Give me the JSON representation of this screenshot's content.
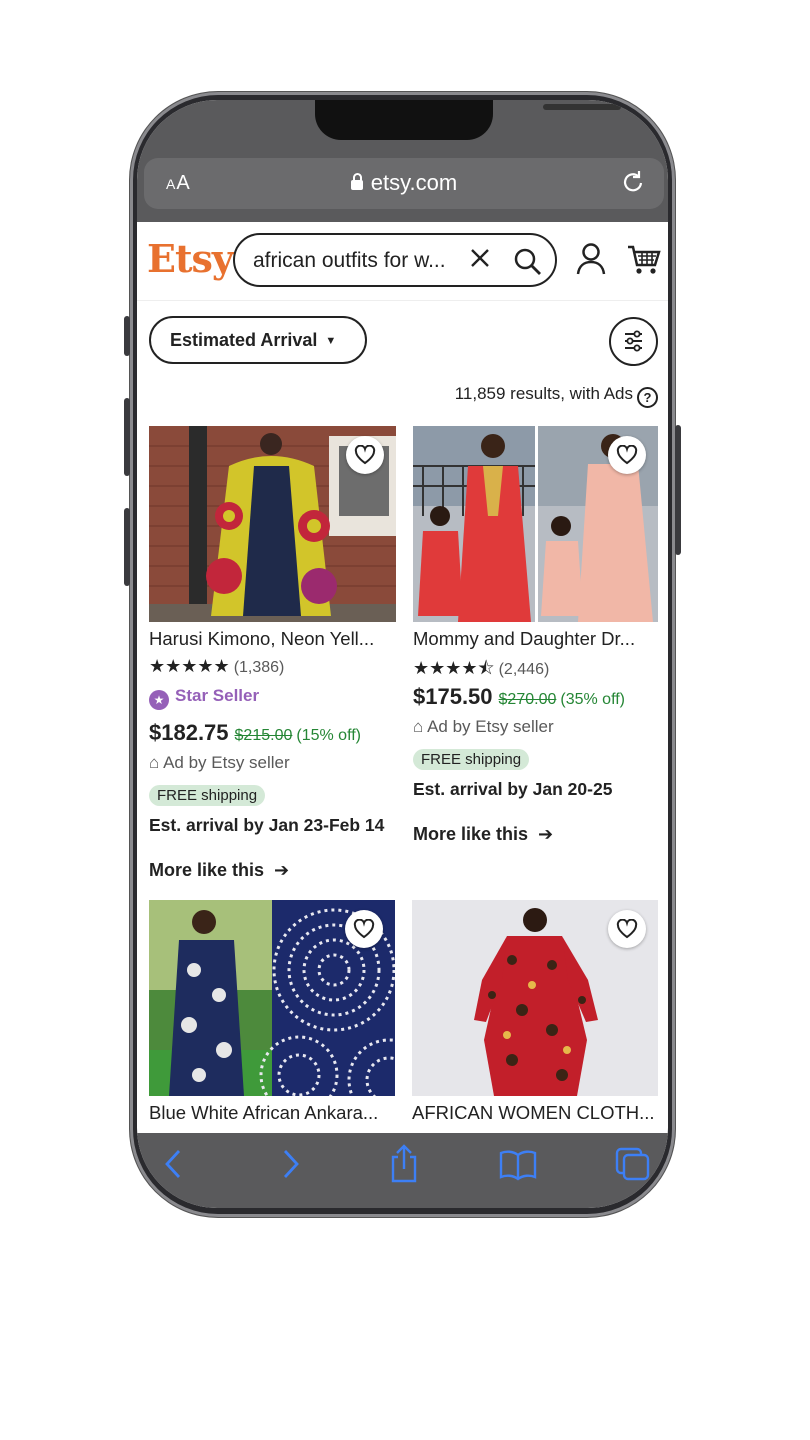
{
  "browser": {
    "text_size_label_small": "A",
    "text_size_label_large": "A",
    "url": "etsy.com"
  },
  "header": {
    "logo": "Etsy",
    "search_value": "african outfits for w..."
  },
  "filters": {
    "arrival_label": "Estimated Arrival"
  },
  "results_text": "11,859 results, with Ads",
  "products": [
    {
      "title": "Harusi Kimono, Neon Yell...",
      "stars": "★★★★★",
      "rating": 5,
      "review_count": "(1,386)",
      "badge": "Star Seller",
      "price": "$182.75",
      "original_price": "$215.00",
      "discount": "(15% off)",
      "ad_label": "Ad by Etsy seller",
      "shipping": "FREE shipping",
      "arrival": "Est. arrival by Jan 23-Feb 14",
      "more": "More like this"
    },
    {
      "title": "Mommy and Daughter Dr...",
      "stars": "★★★★⯪",
      "rating": 4.5,
      "review_count": "(2,446)",
      "price": "$175.50",
      "original_price": "$270.00",
      "discount": "(35% off)",
      "ad_label": "Ad by Etsy seller",
      "shipping": "FREE shipping",
      "arrival": "Est. arrival by Jan 20-25",
      "more": "More like this"
    },
    {
      "title": "Blue White African Ankara..."
    },
    {
      "title": "AFRICAN WOMEN CLOTH..."
    }
  ],
  "colors": {
    "brand": "#e8712f",
    "sale_green": "#258635",
    "star_seller_purple": "#9560b8",
    "ios_blue": "#3d7ff5"
  },
  "toolbar_icons": [
    "back-icon",
    "forward-icon",
    "share-icon",
    "bookmarks-icon",
    "tabs-icon"
  ]
}
